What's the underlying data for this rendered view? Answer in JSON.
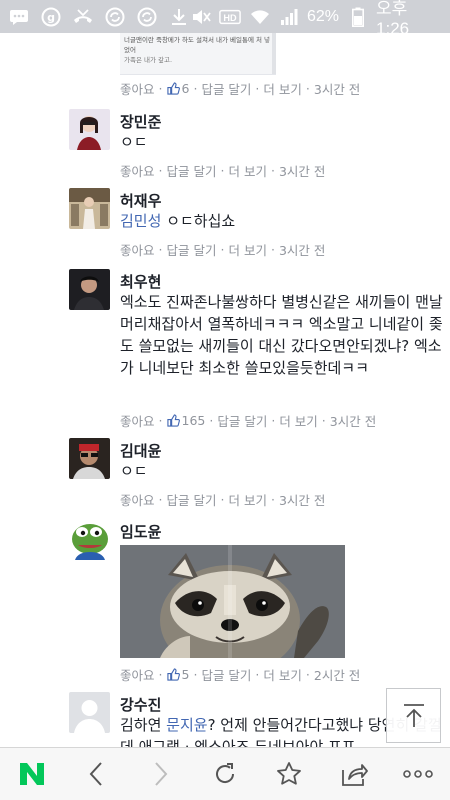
{
  "status_bar": {
    "battery_percent": "62%",
    "time": "오후 1:26",
    "left_icons": [
      "chat-bubble-icon",
      "g-circle-icon",
      "missed-call-icon",
      "sync-icon",
      "sync-icon",
      "download-icon"
    ],
    "right_icons": [
      "mute-icon",
      "hd-icon",
      "wifi-icon",
      "signal-icon",
      "battery-icon"
    ]
  },
  "top_post": {
    "image_lines": [
      "너글맨이란 죽창메가 하도 설쳐서 내가 베일통에 처 넣",
      "었어",
      "가족은 내가 갚고."
    ],
    "like_label": "좋아요",
    "like_count": "6",
    "reply_label": "답글 달기",
    "more_label": "더 보기",
    "time": "3시간 전"
  },
  "comments": [
    {
      "author": "장민준",
      "text": "ㅇㄷ",
      "like_label": "좋아요",
      "reply_label": "답글 달기",
      "more_label": "더 보기",
      "time": "3시간 전"
    },
    {
      "author": "허재우",
      "mention": "김민성",
      "text": "ㅇㄷ하십쇼",
      "like_label": "좋아요",
      "reply_label": "답글 달기",
      "more_label": "더 보기",
      "time": "3시간 전"
    },
    {
      "author": "최우현",
      "text": "엑소도 진짜존나불쌍하다 별병신같은 새끼들이 맨날 머리채잡아서 열폭하네ㅋㅋㅋ 엑소말고 니네같이 좆도 쓸모없는 새끼들이 대신 갔다오면안되겠냐? 엑소가 니네보단 최소한 쓸모있을듯한데ㅋㅋ",
      "like_label": "좋아요",
      "like_count": "165",
      "reply_label": "답글 달기",
      "more_label": "더 보기",
      "time": "3시간 전"
    },
    {
      "author": "김대윤",
      "text": "ㅇㄷ",
      "like_label": "좋아요",
      "reply_label": "답글 달기",
      "more_label": "더 보기",
      "time": "3시간 전"
    },
    {
      "author": "임도윤",
      "photo": "raccoon-photo",
      "like_label": "좋아요",
      "like_count": "5",
      "reply_label": "답글 달기",
      "more_label": "더 보기",
      "time": "2시간 전"
    },
    {
      "author": "강수진",
      "text_before": "김하연 ",
      "mention": "문지윤",
      "text_after": "? 언제 안들어간다고했냐 당연히 갈껄데 애그램 · 엑소아조 두네브아야 프프"
    }
  ],
  "bottom_nav": {
    "items": [
      "naver-logo-icon",
      "back-icon",
      "forward-icon",
      "refresh-icon",
      "bookmark-star-icon",
      "share-icon",
      "more-icon"
    ]
  },
  "colors": {
    "status_bar_bg": "#cfd1d6",
    "link_blue": "#4267b2",
    "meta_gray": "#90949c",
    "naver_green": "#03c75a"
  }
}
